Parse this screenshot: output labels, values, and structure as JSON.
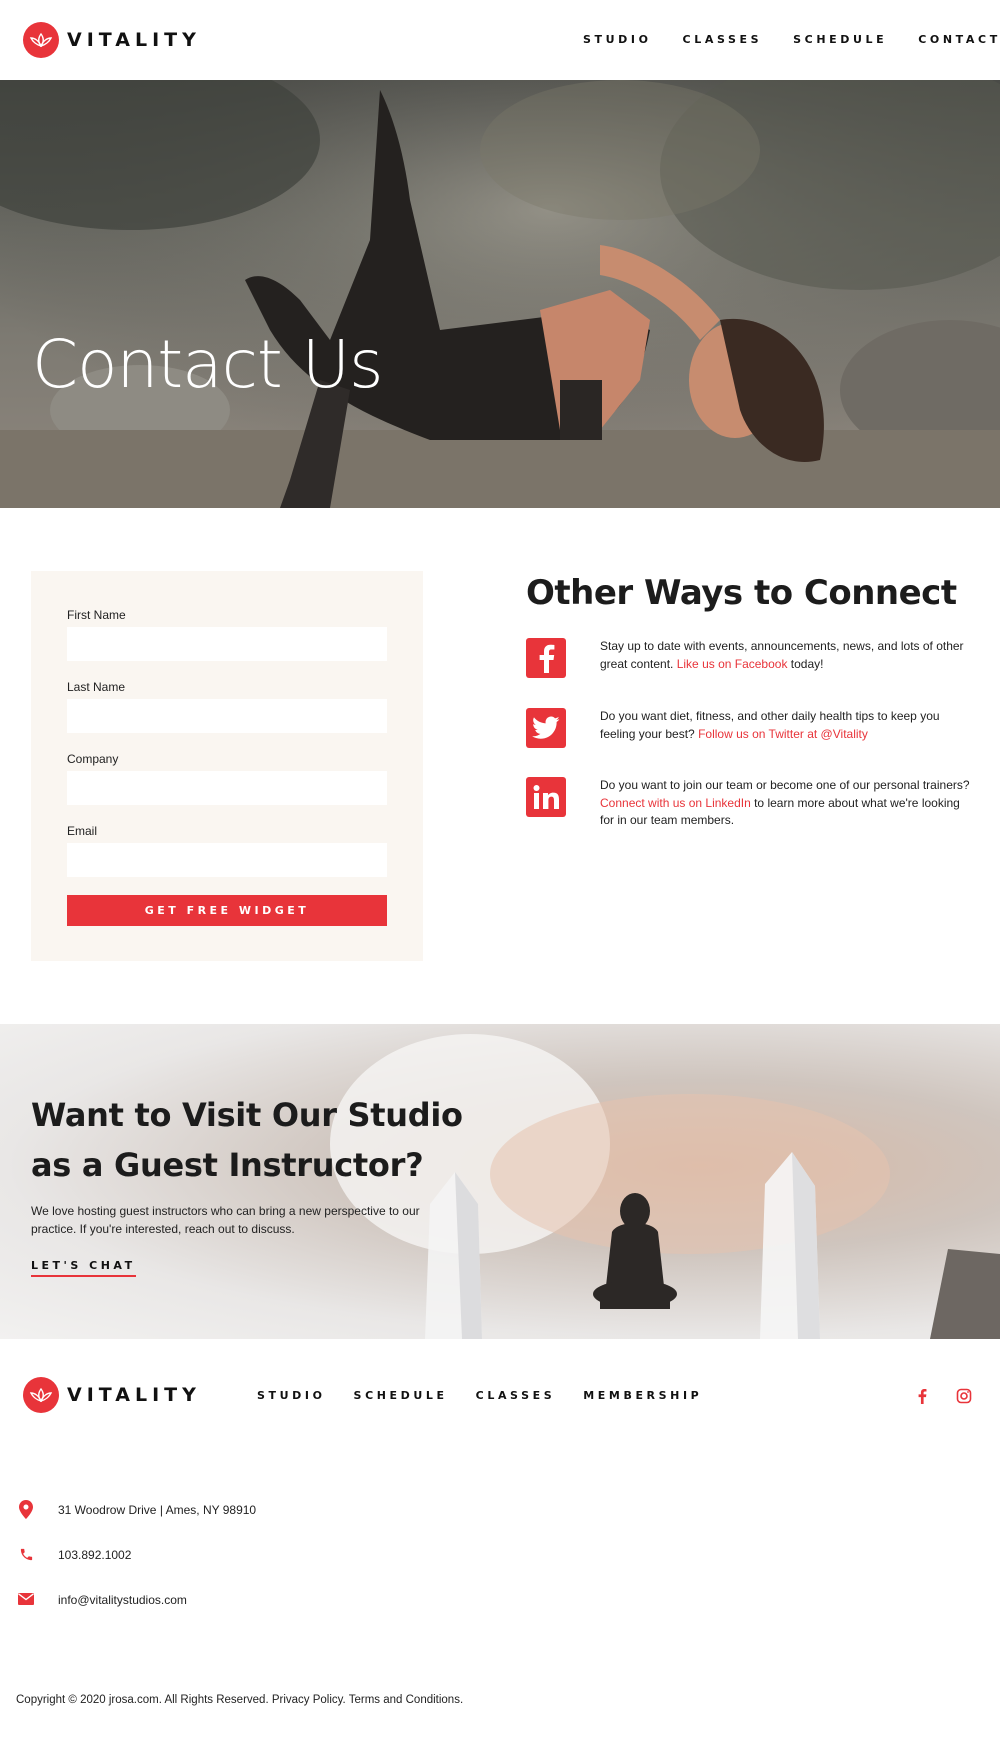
{
  "brand": {
    "name": "VITALITY",
    "accent": "#e8343a"
  },
  "header": {
    "nav": [
      "STUDIO",
      "CLASSES",
      "SCHEDULE",
      "CONTACT"
    ]
  },
  "hero": {
    "title": "Contact Us"
  },
  "form": {
    "fields": [
      {
        "label": "First Name",
        "value": ""
      },
      {
        "label": "Last Name",
        "value": ""
      },
      {
        "label": "Company",
        "value": ""
      },
      {
        "label": "Email",
        "value": ""
      }
    ],
    "submit_label": "GET FREE WIDGET"
  },
  "connect": {
    "title": "Other Ways to Connect",
    "items": [
      {
        "icon": "facebook-icon",
        "before": "Stay up to date with events, announcements, news, and lots of other great content. ",
        "link": "Like us on Facebook",
        "after": " today!"
      },
      {
        "icon": "twitter-icon",
        "before": "Do you want diet, fitness, and other daily health tips to keep you feeling your best? ",
        "link": "Follow us on Twitter at @Vitality",
        "after": ""
      },
      {
        "icon": "linkedin-icon",
        "before": "Do you want to join our team or become one of our personal trainers? ",
        "link": "Connect with us on LinkedIn",
        "after": " to learn more about what we're looking for in our team members."
      }
    ]
  },
  "guest": {
    "title": "Want to Visit Our Studio as a Guest Instructor?",
    "body": "We love hosting guest instructors who can bring a new perspective to our practice. If you're interested, reach out to discuss.",
    "cta": "LET'S CHAT"
  },
  "footer": {
    "nav": [
      "STUDIO",
      "SCHEDULE",
      "CLASSES",
      "MEMBERSHIP"
    ],
    "social": [
      "facebook-icon",
      "instagram-icon"
    ],
    "address": "31 Woodrow Drive | Ames, NY 98910",
    "phone": "103.892.1002",
    "email": "info@vitalitystudios.com",
    "copyright": "Copyright © 2020 jrosa.com. All Rights Reserved. Privacy Policy. Terms and Conditions."
  }
}
